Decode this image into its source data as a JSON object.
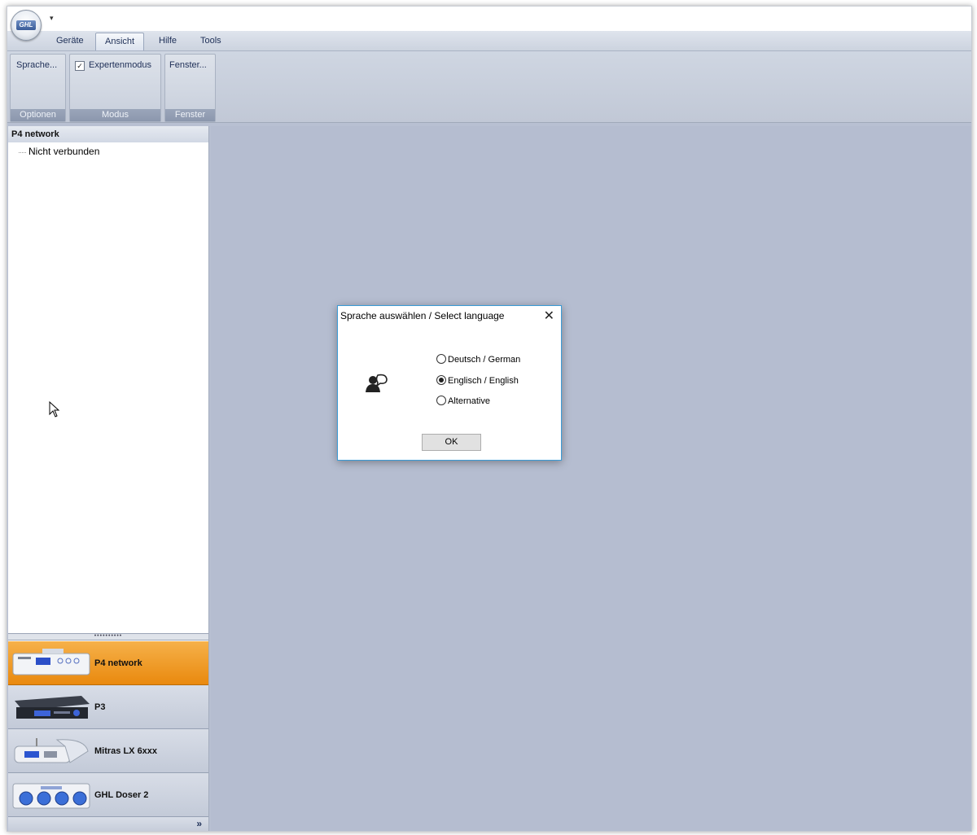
{
  "app": {
    "logo_text": "GHL",
    "quick_access_glyph": "▾"
  },
  "tabs": [
    {
      "label": "Geräte"
    },
    {
      "label": "Ansicht"
    },
    {
      "label": "Hilfe"
    },
    {
      "label": "Tools"
    }
  ],
  "ribbon": {
    "groups": [
      {
        "label": "Optionen",
        "button": "Sprache..."
      },
      {
        "label": "Modus",
        "checkbox": "Expertenmodus",
        "checked": true
      },
      {
        "label": "Fenster",
        "button": "Fenster..."
      }
    ]
  },
  "tree": {
    "header": "P4 network",
    "items": [
      {
        "label": "Nicht verbunden"
      }
    ]
  },
  "splitter_grip": "••••••••••",
  "nav": {
    "items": [
      {
        "label": "P4 network",
        "selected": true
      },
      {
        "label": "P3"
      },
      {
        "label": "Mitras LX 6xxx"
      },
      {
        "label": "GHL Doser 2"
      }
    ],
    "more_glyph": "»"
  },
  "dialog": {
    "title": "Sprache auswählen / Select language",
    "close_glyph": "✕",
    "icon": "person-speech-icon",
    "options": [
      {
        "label": "Deutsch / German",
        "selected": false
      },
      {
        "label": "Englisch / English",
        "selected": true
      },
      {
        "label": "Alternative",
        "selected": false
      }
    ],
    "ok_label": "OK"
  },
  "colors": {
    "mdi_background": "#b5bdd0",
    "nav_selected": "#f0a030",
    "dialog_border": "#3a9bd6"
  }
}
